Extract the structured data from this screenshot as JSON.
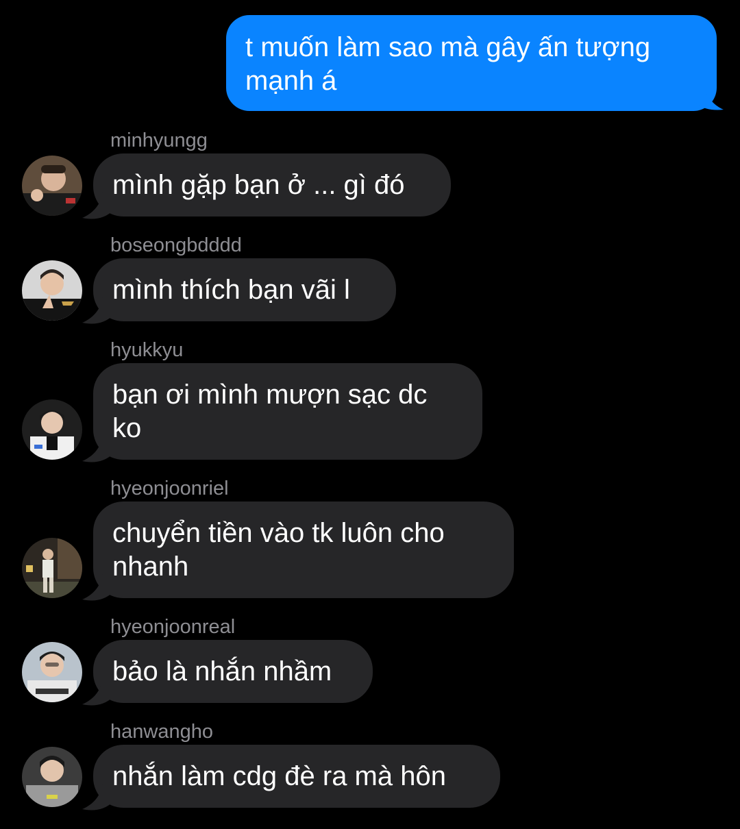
{
  "outgoing": {
    "text": "t muốn làm sao mà gây ấn tượng mạnh á"
  },
  "messages": [
    {
      "sender": "minhyungg",
      "text": "mình gặp bạn ở ... gì đó",
      "avatar_bg": "#6b5a4a"
    },
    {
      "sender": "boseongbdddd",
      "text": "mình thích bạn vãi l",
      "avatar_bg": "#c9c9c9"
    },
    {
      "sender": "hyukkyu",
      "text": "bạn ơi mình mượn sạc dc ko",
      "avatar_bg": "#2a2a2a"
    },
    {
      "sender": "hyeonjoonriel",
      "text": "chuyển tiền vào tk luôn cho nhanh",
      "avatar_bg": "#3b342c"
    },
    {
      "sender": "hyeonjoonreal",
      "text": "bảo là nhắn nhầm",
      "avatar_bg": "#b8c2cc"
    },
    {
      "sender": "hanwangho",
      "text": "nhắn làm cdg đè ra mà hôn",
      "avatar_bg": "#3a3a3a"
    }
  ],
  "colors": {
    "outgoing_bubble": "#0a84ff",
    "incoming_bubble": "#262628",
    "sender_name": "#8e8e93",
    "background": "#000000"
  }
}
